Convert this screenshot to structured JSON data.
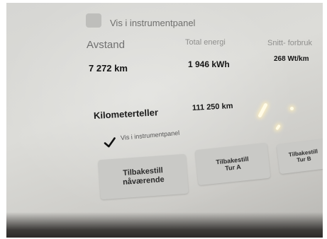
{
  "display": {
    "top_checkbox_label": "Vis i instrumentpanel"
  },
  "trip": {
    "distance_label": "Avstand",
    "energy_label": "Total energi",
    "consumption_label": "Snitt- forbruk",
    "distance_value": "7 272 km",
    "energy_value": "1 946 kWh",
    "consumption_value": "268 Wt/km"
  },
  "odometer": {
    "label": "Kilometerteller",
    "value": "111 250 km",
    "checkbox_label": "Vis i instrumentpanel",
    "checkbox_checked": true
  },
  "buttons": {
    "reset_current_line1": "Tilbakestill",
    "reset_current_line2": "nåværende",
    "reset_a_line1": "Tilbakestill",
    "reset_a_line2": "Tur A",
    "reset_b_line1": "Tilbakestill",
    "reset_b_line2": "Tur B"
  },
  "colors": {
    "background": "#d6d6d3",
    "button": "#c9c9c6",
    "text": "#1a1a1a"
  }
}
